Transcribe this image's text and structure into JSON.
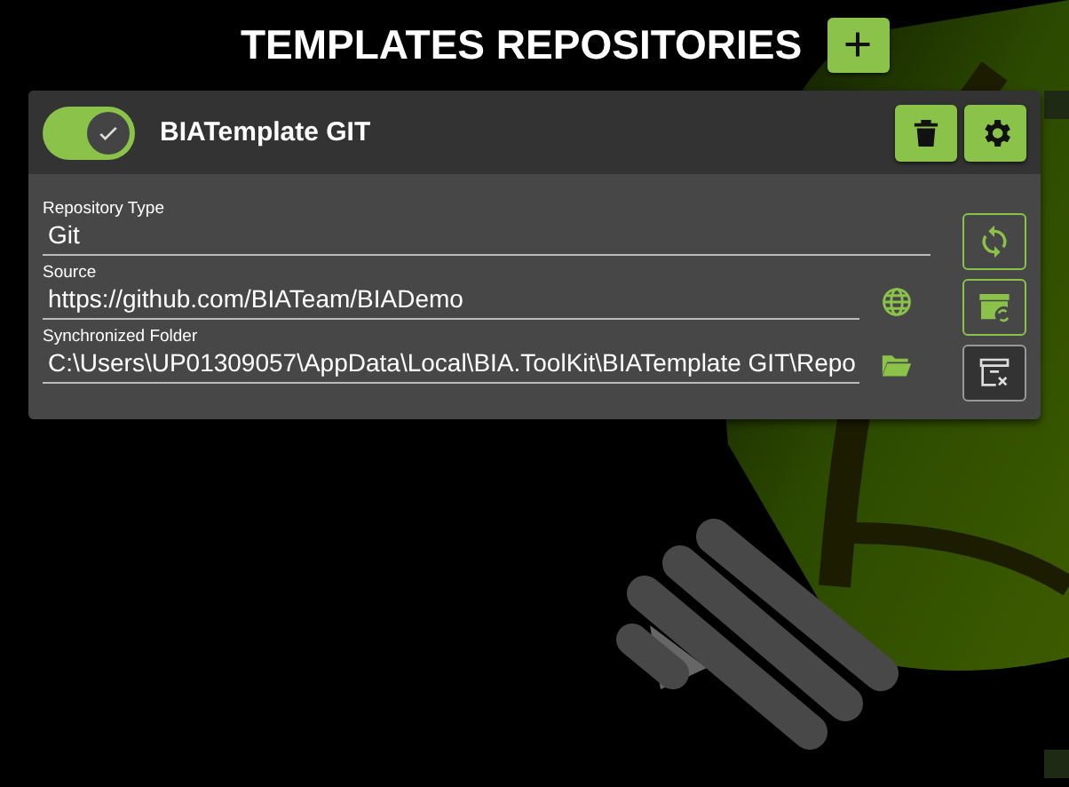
{
  "header": {
    "title": "TEMPLATES REPOSITORIES"
  },
  "repositories": [
    {
      "name": "BIATemplate GIT",
      "enabled": true,
      "fields": [
        {
          "label": "Repository Type",
          "value": "Git"
        },
        {
          "label": "Source",
          "value": "https://github.com/BIATeam/BIADemo",
          "kind": "web"
        },
        {
          "label": "Synchronized Folder",
          "value": "C:\\Users\\UP01309057\\AppData\\Local\\BIA.ToolKit\\BIATemplate GIT\\Repo",
          "kind": "folder"
        }
      ],
      "side_actions": [
        {
          "kind": "sync",
          "highlighted": false
        },
        {
          "kind": "archive-sync",
          "highlighted": false
        },
        {
          "kind": "clean",
          "highlighted": true
        }
      ]
    }
  ]
}
